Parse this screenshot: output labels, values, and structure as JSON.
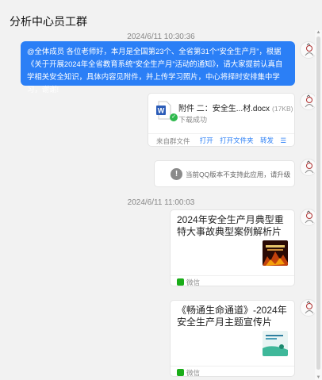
{
  "header": {
    "title": "分析中心员工群"
  },
  "messages": {
    "time1": "2024/6/11 10:30:36",
    "announcement": "@全体成员 各位老师好，本月是全国第23个、全省第31个“安全生产月”，根据《关于开展2024年全省教育系统“安全生产月”活动的通知》，请大家提前认真自学相关安全知识，具体内容见附件，并上传学习照片，中心将择时安排集中学习，谢谢!",
    "file": {
      "name": "附件 二：安全生...材.docx",
      "size": "(17KB)",
      "status": "下载成功",
      "source": "来自群文件",
      "actions": {
        "open": "打开",
        "open_folder": "打开文件夹",
        "forward": "转发",
        "menu": "☰"
      }
    },
    "unsupported": "当前QQ版本不支持此应用，请升级",
    "time2": "2024/6/11 11:00:03",
    "share1": {
      "title": "2024年安全生产月典型重特大事故典型案例解析片",
      "source": "微信"
    },
    "share2": {
      "title": "《畅通生命通道》-2024年安全生产月主题宣传片",
      "source": "微信"
    }
  },
  "colors": {
    "bubble": "#2b7ff6",
    "link": "#2b7ff6",
    "wechat": "#1aad19",
    "success": "#2db84c"
  },
  "icons": [
    "avatar",
    "word-file-icon",
    "download-success-icon",
    "warning-icon",
    "wechat-icon",
    "video-thumbnail",
    "scroll-arrow-icon"
  ]
}
